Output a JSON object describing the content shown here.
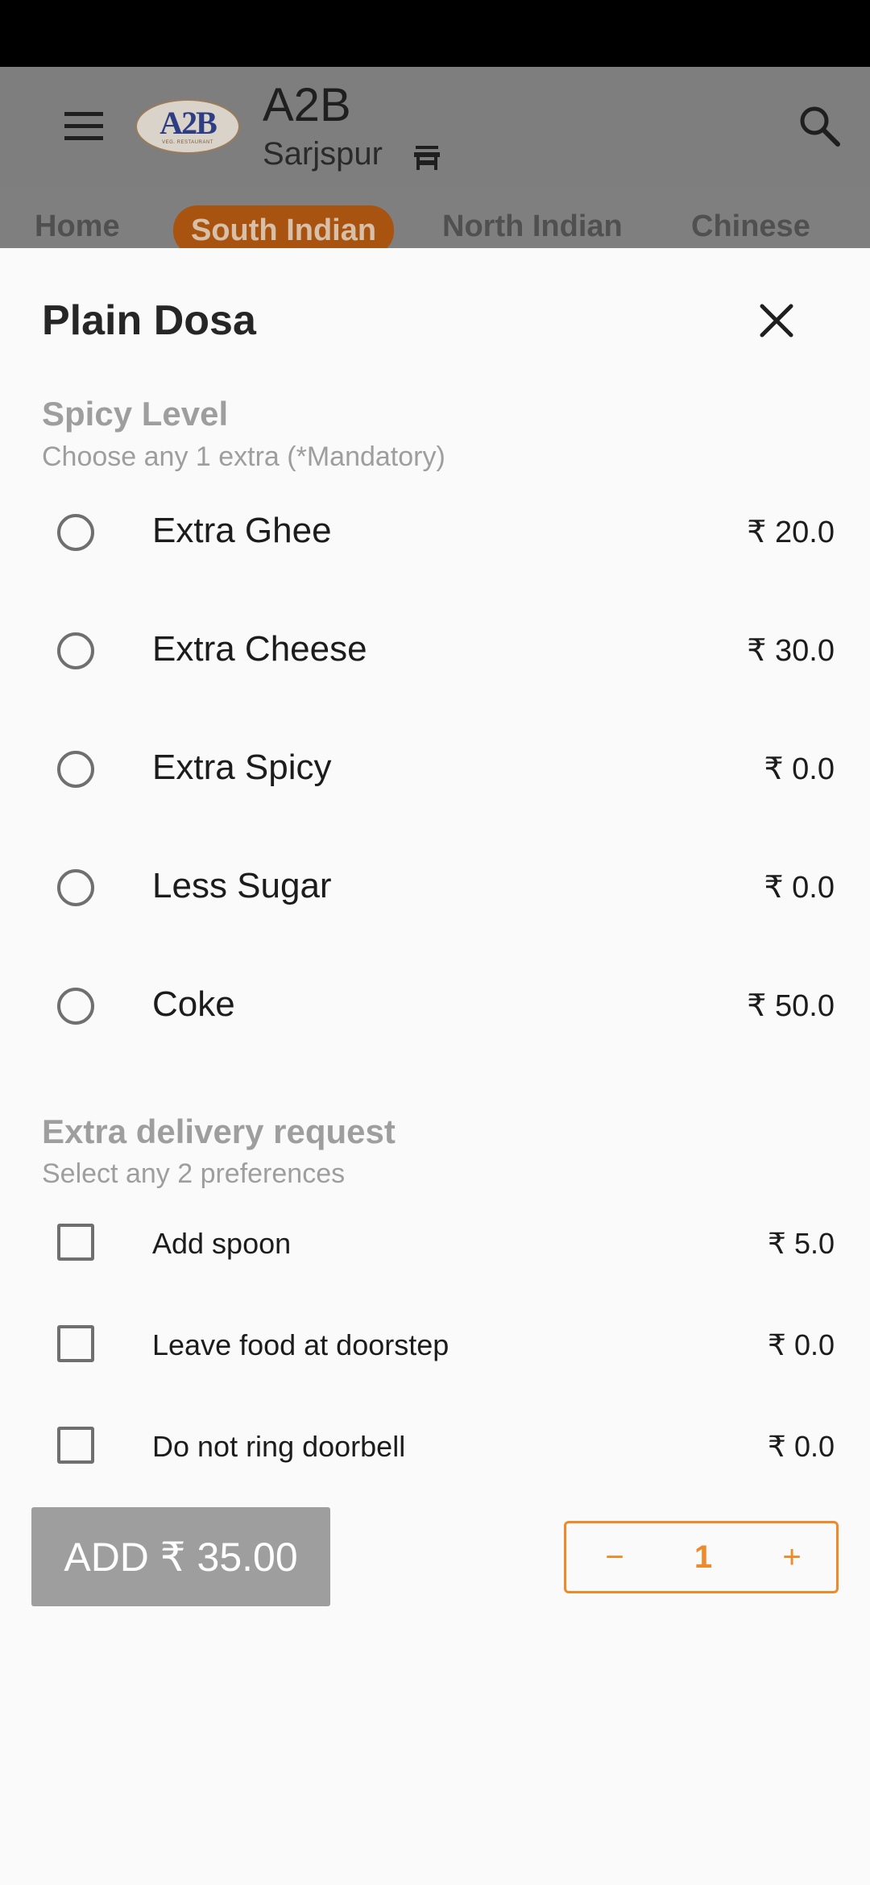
{
  "app_bar": {
    "title": "A2B",
    "subtitle": "Sarjspur",
    "logo_text": "A2B",
    "logo_subtext": "VEG. RESTAURANT",
    "icons": [
      "menu-icon",
      "store-icon",
      "search-icon"
    ]
  },
  "categories": [
    {
      "label": "Home",
      "active": false
    },
    {
      "label": "South Indian",
      "active": true
    },
    {
      "label": "North Indian",
      "active": false
    },
    {
      "label": "Chinese",
      "active": false
    }
  ],
  "sheet": {
    "title": "Plain Dosa",
    "close_icon": "close-icon",
    "spicy_section": {
      "title": "Spicy Level",
      "subtitle": "Choose any 1 extra (*Mandatory)",
      "options": [
        {
          "label": "Extra Ghee",
          "price": "₹ 20.0",
          "selected": false
        },
        {
          "label": "Extra Cheese",
          "price": "₹ 30.0",
          "selected": false
        },
        {
          "label": "Extra Spicy",
          "price": "₹ 0.0",
          "selected": false
        },
        {
          "label": "Less Sugar",
          "price": "₹ 0.0",
          "selected": false
        },
        {
          "label": "Coke",
          "price": "₹ 50.0",
          "selected": false
        }
      ]
    },
    "delivery_section": {
      "title": "Extra delivery request",
      "subtitle": "Select any 2 preferences",
      "options": [
        {
          "label": "Add spoon",
          "price": "₹ 5.0",
          "checked": false
        },
        {
          "label": "Leave food at doorstep",
          "price": "₹ 0.0",
          "checked": false
        },
        {
          "label": "Do not ring doorbell",
          "price": "₹ 0.0",
          "checked": false
        }
      ]
    },
    "add_button_label": "ADD ₹ 35.00",
    "stepper": {
      "minus": "−",
      "value": "1",
      "plus": "+"
    }
  },
  "colors": {
    "accent": "#ef8a2a",
    "active_tab": "#a8530f",
    "add_button": "#9e9e9e"
  }
}
